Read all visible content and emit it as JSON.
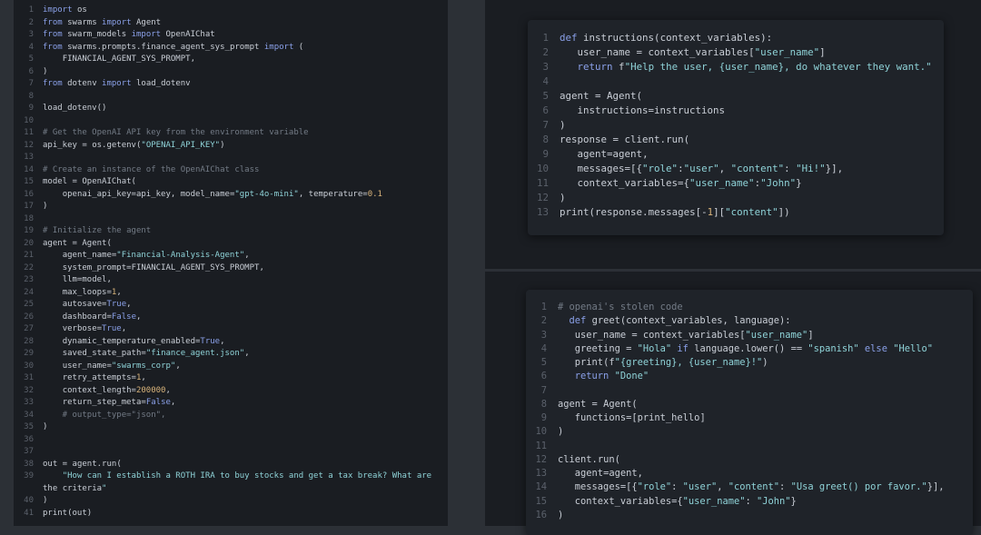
{
  "left_editor": {
    "lines": [
      {
        "n": "1",
        "text": "import os",
        "tone": "code"
      },
      {
        "n": "2",
        "text": "from swarms import Agent",
        "tone": "code"
      },
      {
        "n": "3",
        "text": "from swarm_models import OpenAIChat",
        "tone": "code"
      },
      {
        "n": "4",
        "text": "from swarms.prompts.finance_agent_sys_prompt import (",
        "tone": "code"
      },
      {
        "n": "5",
        "text": "    FINANCIAL_AGENT_SYS_PROMPT,",
        "tone": "code"
      },
      {
        "n": "6",
        "text": ")",
        "tone": "code"
      },
      {
        "n": "7",
        "text": "from dotenv import load_dotenv",
        "tone": "code"
      },
      {
        "n": "8",
        "text": "",
        "tone": "code"
      },
      {
        "n": "9",
        "text": "load_dotenv()",
        "tone": "code"
      },
      {
        "n": "10",
        "text": "",
        "tone": "code"
      },
      {
        "n": "11",
        "text": "# Get the OpenAI API key from the environment variable",
        "tone": "comment"
      },
      {
        "n": "12",
        "text": "api_key = os.getenv(\"OPENAI_API_KEY\")",
        "tone": "code"
      },
      {
        "n": "13",
        "text": "",
        "tone": "code"
      },
      {
        "n": "14",
        "text": "# Create an instance of the OpenAIChat class",
        "tone": "comment"
      },
      {
        "n": "15",
        "text": "model = OpenAIChat(",
        "tone": "code"
      },
      {
        "n": "16",
        "text": "    openai_api_key=api_key, model_name=\"gpt-4o-mini\", temperature=0.1",
        "tone": "code"
      },
      {
        "n": "17",
        "text": ")",
        "tone": "code"
      },
      {
        "n": "18",
        "text": "",
        "tone": "code"
      },
      {
        "n": "19",
        "text": "# Initialize the agent",
        "tone": "comment"
      },
      {
        "n": "20",
        "text": "agent = Agent(",
        "tone": "code"
      },
      {
        "n": "21",
        "text": "    agent_name=\"Financial-Analysis-Agent\",",
        "tone": "code"
      },
      {
        "n": "22",
        "text": "    system_prompt=FINANCIAL_AGENT_SYS_PROMPT,",
        "tone": "code"
      },
      {
        "n": "23",
        "text": "    llm=model,",
        "tone": "code"
      },
      {
        "n": "24",
        "text": "    max_loops=1,",
        "tone": "code"
      },
      {
        "n": "25",
        "text": "    autosave=True,",
        "tone": "code"
      },
      {
        "n": "26",
        "text": "    dashboard=False,",
        "tone": "code"
      },
      {
        "n": "27",
        "text": "    verbose=True,",
        "tone": "code"
      },
      {
        "n": "28",
        "text": "    dynamic_temperature_enabled=True,",
        "tone": "code"
      },
      {
        "n": "29",
        "text": "    saved_state_path=\"finance_agent.json\",",
        "tone": "code"
      },
      {
        "n": "30",
        "text": "    user_name=\"swarms_corp\",",
        "tone": "code"
      },
      {
        "n": "31",
        "text": "    retry_attempts=1,",
        "tone": "code"
      },
      {
        "n": "32",
        "text": "    context_length=200000,",
        "tone": "code"
      },
      {
        "n": "33",
        "text": "    return_step_meta=False,",
        "tone": "code"
      },
      {
        "n": "34",
        "text": "    # output_type=\"json\",",
        "tone": "comment"
      },
      {
        "n": "35",
        "text": ")",
        "tone": "code"
      },
      {
        "n": "36",
        "text": "",
        "tone": "code"
      },
      {
        "n": "37",
        "text": "",
        "tone": "code"
      },
      {
        "n": "38",
        "text": "out = agent.run(",
        "tone": "code"
      },
      {
        "n": "39",
        "text": "    \"How can I establish a ROTH IRA to buy stocks and get a tax break? What are",
        "tone": "code"
      },
      {
        "n": "",
        "text": "the criteria\"",
        "tone": "code"
      },
      {
        "n": "40",
        "text": ")",
        "tone": "code"
      },
      {
        "n": "41",
        "text": "print(out)",
        "tone": "code"
      }
    ]
  },
  "top_card": {
    "lines": [
      {
        "n": "1",
        "text": "def instructions(context_variables):",
        "tone": "code"
      },
      {
        "n": "2",
        "text": "   user_name = context_variables[\"user_name\"]",
        "tone": "code"
      },
      {
        "n": "3",
        "text": "   return f\"Help the user, {user_name}, do whatever they want.\"",
        "tone": "code"
      },
      {
        "n": "4",
        "text": "",
        "tone": "code"
      },
      {
        "n": "5",
        "text": "agent = Agent(",
        "tone": "code"
      },
      {
        "n": "6",
        "text": "   instructions=instructions",
        "tone": "code"
      },
      {
        "n": "7",
        "text": ")",
        "tone": "code"
      },
      {
        "n": "8",
        "text": "response = client.run(",
        "tone": "code"
      },
      {
        "n": "9",
        "text": "   agent=agent,",
        "tone": "code"
      },
      {
        "n": "10",
        "text": "   messages=[{\"role\":\"user\", \"content\": \"Hi!\"}],",
        "tone": "code"
      },
      {
        "n": "11",
        "text": "   context_variables={\"user_name\":\"John\"}",
        "tone": "code"
      },
      {
        "n": "12",
        "text": ")",
        "tone": "code"
      },
      {
        "n": "13",
        "text": "print(response.messages[-1][\"content\"])",
        "tone": "code"
      }
    ]
  },
  "bottom_card": {
    "lines": [
      {
        "n": "1",
        "text": "# openai's stolen code",
        "tone": "comment"
      },
      {
        "n": "2",
        "text": "  def greet(context_variables, language):",
        "tone": "code"
      },
      {
        "n": "3",
        "text": "   user_name = context_variables[\"user_name\"]",
        "tone": "code"
      },
      {
        "n": "4",
        "text": "   greeting = \"Hola\" if language.lower() == \"spanish\" else \"Hello\"",
        "tone": "code"
      },
      {
        "n": "5",
        "text": "   print(f\"{greeting}, {user_name}!\")",
        "tone": "code"
      },
      {
        "n": "6",
        "text": "   return \"Done\"",
        "tone": "code"
      },
      {
        "n": "7",
        "text": "",
        "tone": "code"
      },
      {
        "n": "8",
        "text": "agent = Agent(",
        "tone": "code"
      },
      {
        "n": "9",
        "text": "   functions=[print_hello]",
        "tone": "code"
      },
      {
        "n": "10",
        "text": ")",
        "tone": "code"
      },
      {
        "n": "11",
        "text": "",
        "tone": "code"
      },
      {
        "n": "12",
        "text": "client.run(",
        "tone": "code"
      },
      {
        "n": "13",
        "text": "   agent=agent,",
        "tone": "code"
      },
      {
        "n": "14",
        "text": "   messages=[{\"role\": \"user\", \"content\": \"Usa greet() por favor.\"}],",
        "tone": "code"
      },
      {
        "n": "15",
        "text": "   context_variables={\"user_name\": \"John\"}",
        "tone": "code"
      },
      {
        "n": "16",
        "text": ")",
        "tone": "code"
      }
    ]
  }
}
